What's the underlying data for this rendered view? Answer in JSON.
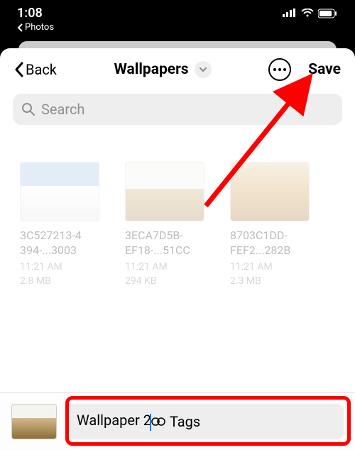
{
  "status": {
    "time": "1:08",
    "back_app": "Photos"
  },
  "header": {
    "back_label": "Back",
    "title": "Wallpapers",
    "save_label": "Save"
  },
  "search": {
    "placeholder": "Search"
  },
  "files": [
    {
      "name_line1": "3C527213-4",
      "name_line2": "394-...3003",
      "time": "11:21 AM",
      "size": "2.8 MB"
    },
    {
      "name_line1": "3ECA7D5B-",
      "name_line2": "EF18-...51CC",
      "time": "11:21 AM",
      "size": "294 KB"
    },
    {
      "name_line1": "8703C1DD-",
      "name_line2": "FEF2...282B",
      "time": "11:21 AM",
      "size": "2.3 MB"
    }
  ],
  "rename": {
    "value": "Wallpaper 2",
    "tags_label": "Tags"
  }
}
